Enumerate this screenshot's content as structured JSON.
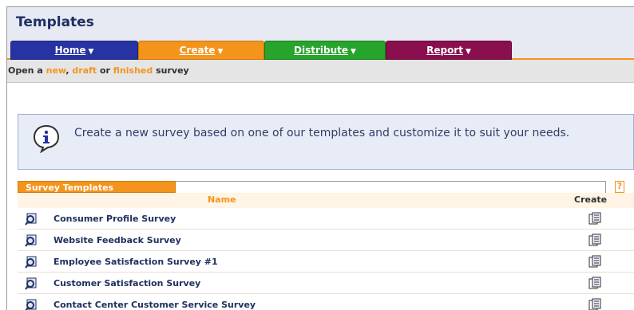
{
  "header": {
    "title": "Templates"
  },
  "tabs": [
    {
      "label": "Home"
    },
    {
      "label": "Create"
    },
    {
      "label": "Distribute"
    },
    {
      "label": "Report"
    }
  ],
  "subnav": {
    "part1": "Open a ",
    "new": "new",
    "part2": ", ",
    "draft": "draft",
    "part3": " or ",
    "finished": "finished",
    "part4": " survey"
  },
  "info": {
    "text": "Create a new survey based on one of our templates and customize it to suit your needs.",
    "icon": "info-icon"
  },
  "panel": {
    "title": "Survey Templates",
    "controls": [
      "?",
      "_",
      ">"
    ],
    "columns": {
      "name": "Name",
      "create": "Create"
    },
    "rows": [
      "Consumer Profile Survey",
      "Website Feedback Survey",
      "Employee Satisfaction Survey #1",
      "Customer Satisfaction Survey",
      "Contact Center Customer Service Survey"
    ]
  },
  "colors": {
    "accent": "#f4941c",
    "home": "#2733a2",
    "distribute": "#27a42b",
    "report": "#8a0f4f"
  }
}
